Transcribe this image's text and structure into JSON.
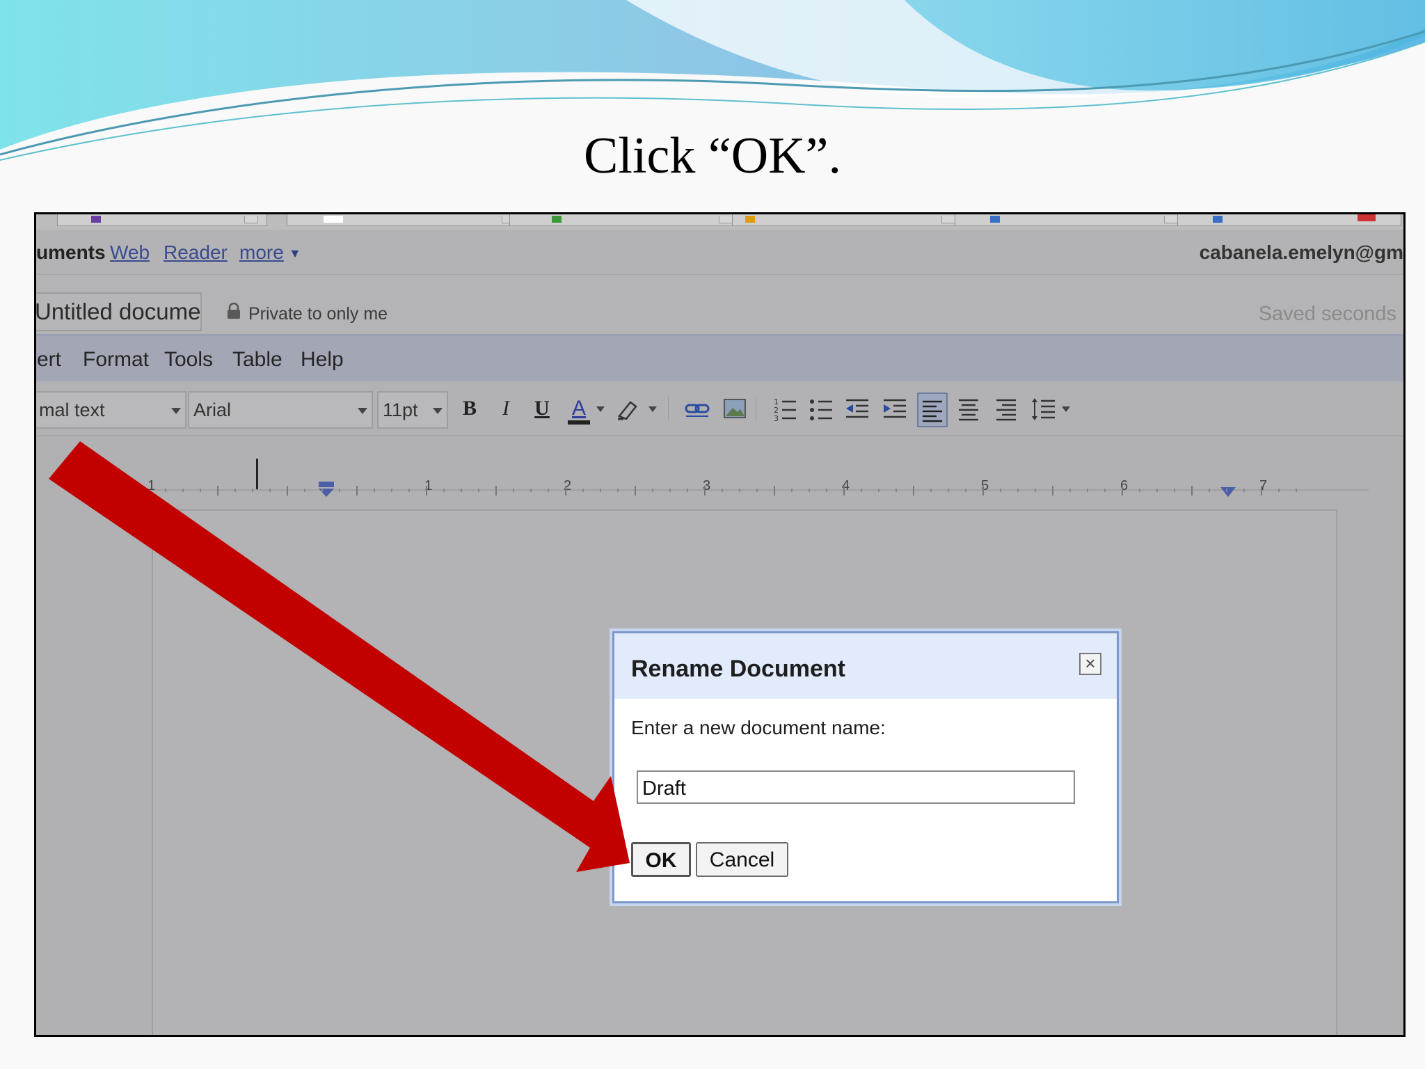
{
  "slide": {
    "title": "Click “OK”."
  },
  "gbar": {
    "current": "uments",
    "links": [
      "Web",
      "Reader",
      "more"
    ],
    "account": "cabanela.emelyn@gm"
  },
  "doc": {
    "title": "Untitled document",
    "privacy": "Private to only me",
    "saved_status": "Saved seconds"
  },
  "menu": {
    "items": [
      "ert",
      "Format",
      "Tools",
      "Table",
      "Help"
    ]
  },
  "toolbar": {
    "style_value": "mal text",
    "font_value": "Arial",
    "size_value": "11pt",
    "bold": "B",
    "italic": "I",
    "underline": "U",
    "text_color": "A"
  },
  "ruler": {
    "labels": [
      "1",
      "1",
      "2",
      "3",
      "4",
      "5",
      "6",
      "7"
    ]
  },
  "dialog": {
    "title": "Rename Document",
    "prompt": "Enter a new document name:",
    "input_value": "Draft",
    "ok_label": "OK",
    "cancel_label": "Cancel"
  },
  "colors": {
    "arrow": "#c20000",
    "dialog_border": "#7c99c8",
    "dialog_header": "#e1ebfb",
    "link": "#3a4b8f",
    "swoosh_teal": "#6fd6e4",
    "swoosh_blue": "#86c4e2"
  },
  "icons": [
    "lock-icon",
    "close-icon",
    "dropdown-arrow-icon",
    "link-icon",
    "image-icon",
    "numbered-list-icon",
    "bulleted-list-icon",
    "decrease-indent-icon",
    "increase-indent-icon",
    "align-left-icon",
    "align-center-icon",
    "align-right-icon",
    "line-spacing-icon",
    "highlight-icon",
    "red-arrow-pointer"
  ]
}
